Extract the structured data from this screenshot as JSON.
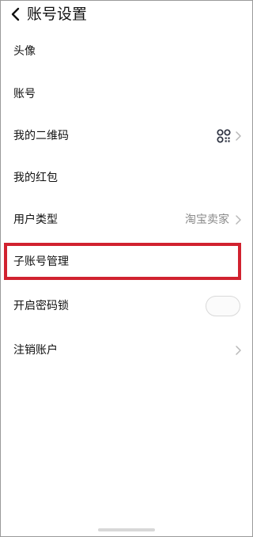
{
  "header": {
    "title": "账号设置"
  },
  "rows": {
    "avatar": {
      "label": "头像"
    },
    "account": {
      "label": "账号"
    },
    "qr_code": {
      "label": "我的二维码"
    },
    "red_packet": {
      "label": "我的红包"
    },
    "user_type": {
      "label": "用户类型",
      "value": "淘宝卖家"
    },
    "sub_account": {
      "label": "子账号管理"
    },
    "password_lock": {
      "label": "开启密码锁",
      "enabled": false
    },
    "cancel_account": {
      "label": "注销账户"
    }
  },
  "icons": {
    "back": "chevron-left-icon",
    "qr": "qr-code-icon",
    "chevron": "chevron-right-icon"
  },
  "colors": {
    "highlight": "#d1222f",
    "secondary_text": "#8a8a8a",
    "chevron": "#b8b8b8"
  }
}
